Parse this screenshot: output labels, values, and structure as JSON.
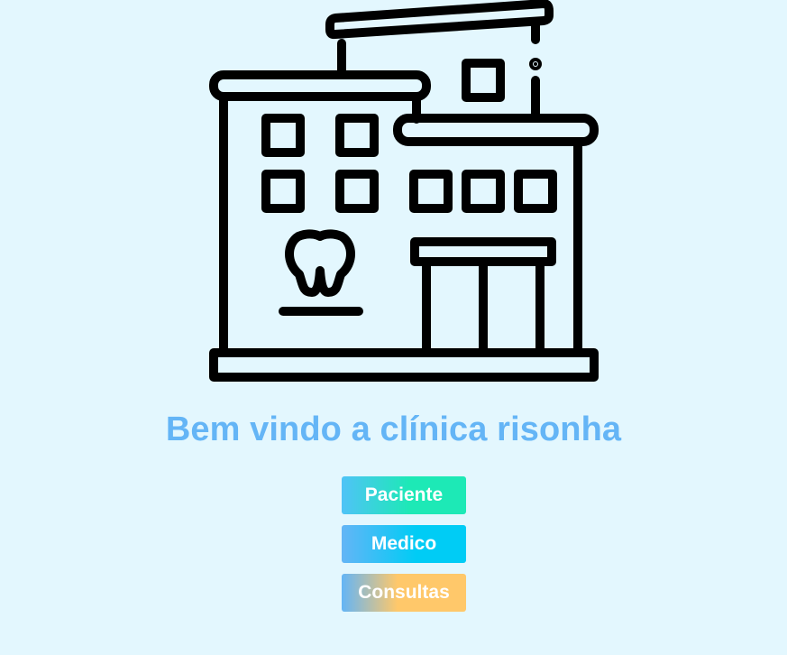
{
  "hero": {
    "illustration": "dental-clinic-building-icon"
  },
  "page": {
    "title": "Bem vindo a clínica risonha"
  },
  "actions": {
    "paciente_label": "Paciente",
    "medico_label": "Medico",
    "consultas_label": "Consultas"
  },
  "colors": {
    "background": "#e3f7fe",
    "title": "#64b5f6",
    "button_text": "#ffffff"
  }
}
